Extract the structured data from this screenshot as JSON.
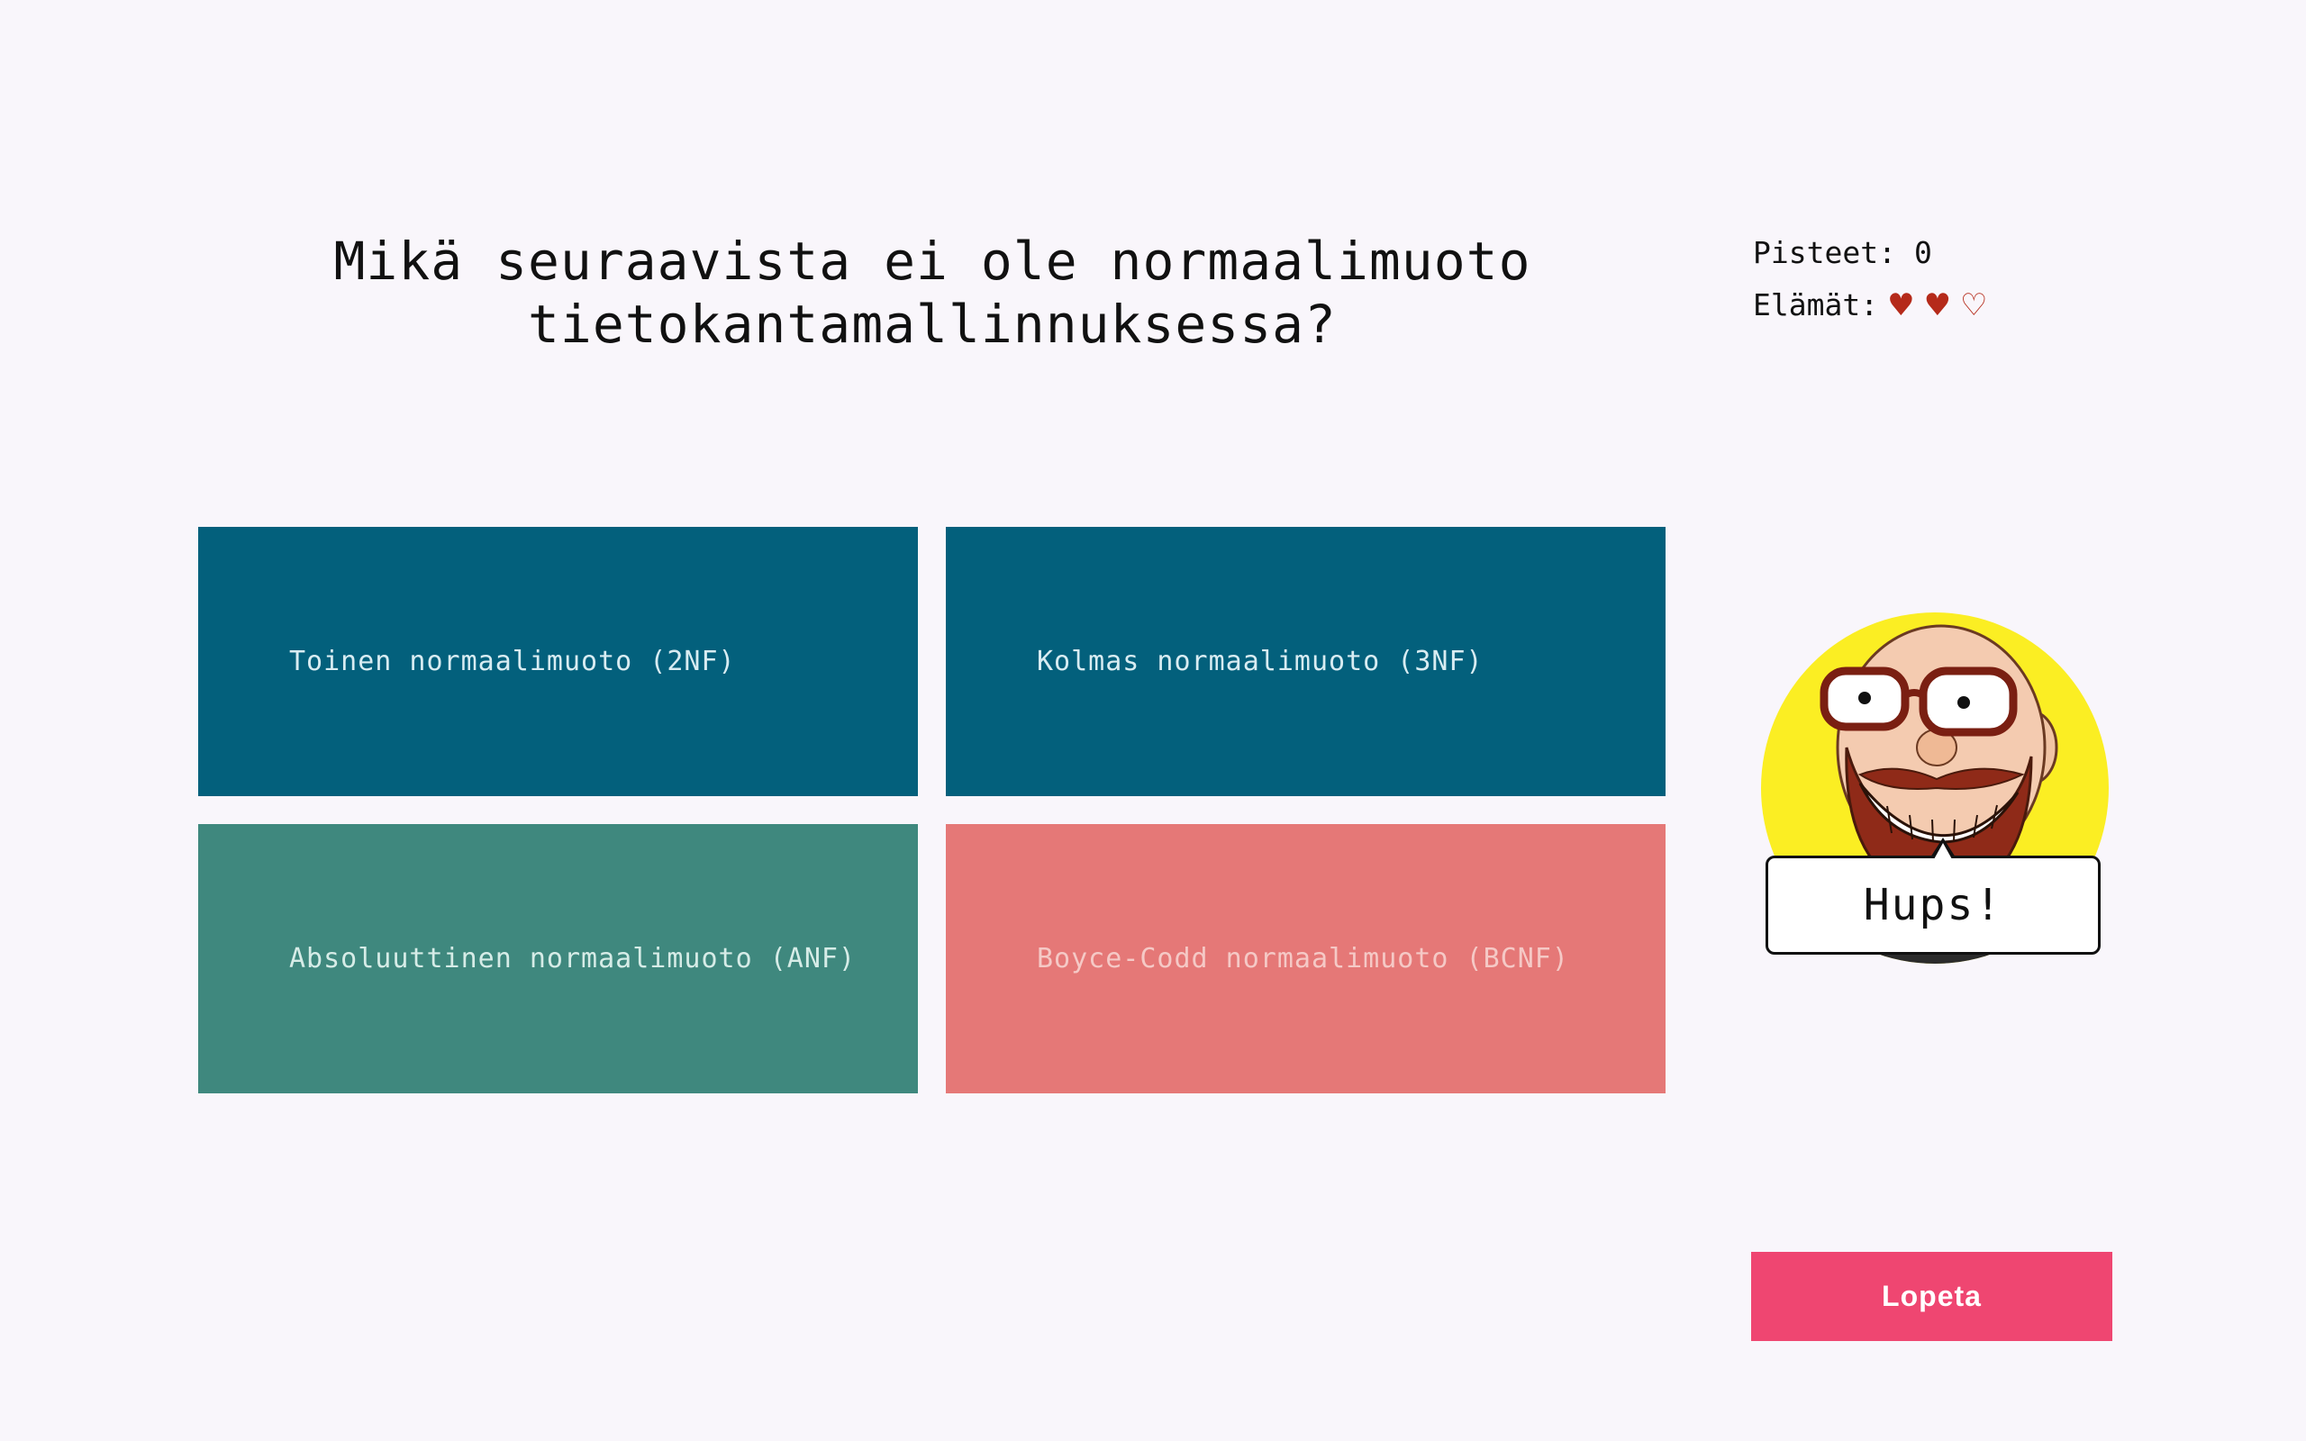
{
  "question": {
    "line1": "Mikä seuraavista ei ole normaalimuoto",
    "line2": "tietokantamallinnuksessa?"
  },
  "answers": [
    {
      "label": "Toinen normaalimuoto (2NF)",
      "color": "#03607c"
    },
    {
      "label": "Kolmas normaalimuoto (3NF)",
      "color": "#03607c"
    },
    {
      "label": "Absoluuttinen normaalimuoto (ANF)",
      "color": "#3f887e"
    },
    {
      "label": "Boyce-Codd normaalimuoto (BCNF)",
      "color": "#e57877"
    }
  ],
  "status": {
    "score_label": "Pisteet:",
    "score_value": "0",
    "lives_label": "Elämät:",
    "lives_total": 3,
    "lives_remaining": 2,
    "heart_full_icon": "♥",
    "heart_empty_icon": "♡"
  },
  "mascot": {
    "icon": "bearded-glasses-man-avatar",
    "speech": "Hups!",
    "circle_color": "#fbee23"
  },
  "quit_button": {
    "label": "Lopeta",
    "color": "#ef4671"
  }
}
